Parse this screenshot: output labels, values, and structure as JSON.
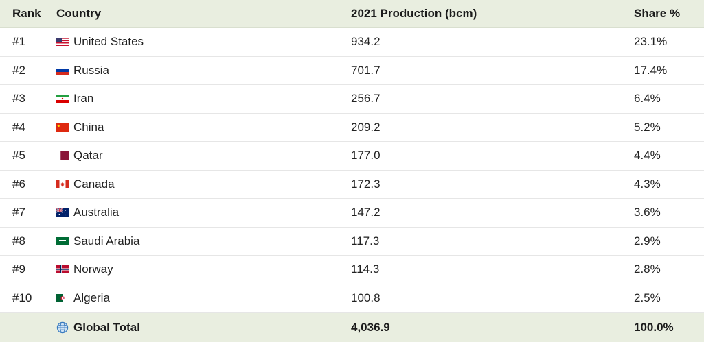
{
  "chart_data": {
    "type": "table",
    "columns": [
      "Rank",
      "Country",
      "2021 Production (bcm)",
      "Share %"
    ],
    "rows": [
      {
        "rank": "#1",
        "country": "United States",
        "production": "934.2",
        "share": "23.1%",
        "flag": "us-flag-icon"
      },
      {
        "rank": "#2",
        "country": "Russia",
        "production": "701.7",
        "share": "17.4%",
        "flag": "russia-flag-icon"
      },
      {
        "rank": "#3",
        "country": "Iran",
        "production": "256.7",
        "share": "6.4%",
        "flag": "iran-flag-icon"
      },
      {
        "rank": "#4",
        "country": "China",
        "production": "209.2",
        "share": "5.2%",
        "flag": "china-flag-icon"
      },
      {
        "rank": "#5",
        "country": "Qatar",
        "production": "177.0",
        "share": "4.4%",
        "flag": "qatar-flag-icon"
      },
      {
        "rank": "#6",
        "country": "Canada",
        "production": "172.3",
        "share": "4.3%",
        "flag": "canada-flag-icon"
      },
      {
        "rank": "#7",
        "country": "Australia",
        "production": "147.2",
        "share": "3.6%",
        "flag": "australia-flag-icon"
      },
      {
        "rank": "#8",
        "country": "Saudi Arabia",
        "production": "117.3",
        "share": "2.9%",
        "flag": "saudi-arabia-flag-icon"
      },
      {
        "rank": "#9",
        "country": "Norway",
        "production": "114.3",
        "share": "2.8%",
        "flag": "norway-flag-icon"
      },
      {
        "rank": "#10",
        "country": "Algeria",
        "production": "100.8",
        "share": "2.5%",
        "flag": "algeria-flag-icon"
      }
    ],
    "total": {
      "rank": "",
      "country": "Global Total",
      "production": "4,036.9",
      "share": "100.0%",
      "icon": "globe-icon"
    }
  },
  "colors": {
    "header_background": "#e9eee0",
    "total_background": "#e9eee0",
    "row_divider": "#e6e6e6"
  }
}
